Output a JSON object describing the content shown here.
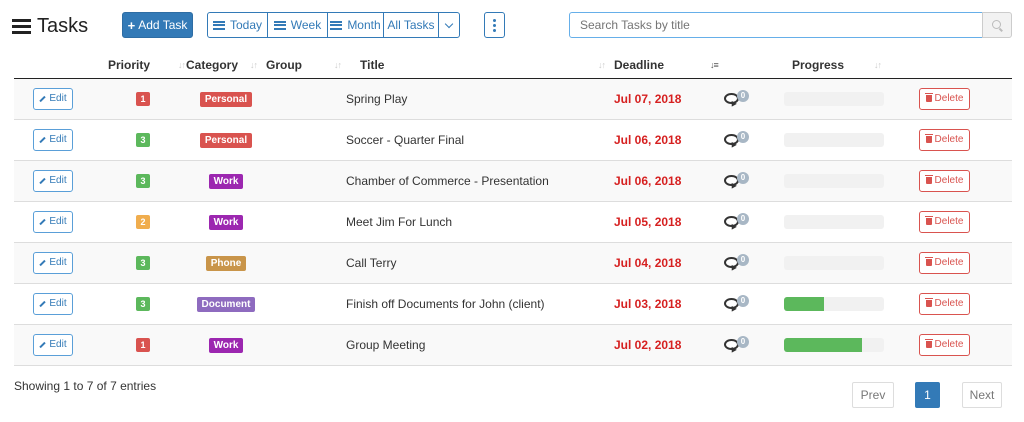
{
  "header": {
    "title": "Tasks",
    "add_task_label": "Add Task",
    "filters": [
      "Today",
      "Week",
      "Month",
      "All Tasks"
    ],
    "search_placeholder": "Search Tasks by title"
  },
  "columns": {
    "priority": "Priority",
    "category": "Category",
    "group": "Group",
    "title": "Title",
    "deadline": "Deadline",
    "progress": "Progress"
  },
  "actions": {
    "edit": "Edit",
    "delete": "Delete"
  },
  "colors": {
    "primary": "#337ab7",
    "danger": "#d9534f",
    "deadline": "#d62020",
    "success": "#5cb85c"
  },
  "priority_colors": {
    "1": "#d9534f",
    "2": "#f0ad4e",
    "3": "#5cb85c"
  },
  "category_colors": {
    "Personal": "#d9534f",
    "Work": "#9c27b0",
    "Phone": "#c9954a",
    "Document": "#8e6bbf"
  },
  "rows": [
    {
      "priority": "1",
      "category": "Personal",
      "group": "",
      "title": "Spring Play",
      "deadline": "Jul 07, 2018",
      "comments": "0",
      "progress": 0
    },
    {
      "priority": "3",
      "category": "Personal",
      "group": "",
      "title": "Soccer - Quarter Final",
      "deadline": "Jul 06, 2018",
      "comments": "0",
      "progress": 0
    },
    {
      "priority": "3",
      "category": "Work",
      "group": "",
      "title": "Chamber of Commerce - Presentation",
      "deadline": "Jul 06, 2018",
      "comments": "0",
      "progress": 0
    },
    {
      "priority": "2",
      "category": "Work",
      "group": "",
      "title": "Meet Jim For Lunch",
      "deadline": "Jul 05, 2018",
      "comments": "0",
      "progress": 0
    },
    {
      "priority": "3",
      "category": "Phone",
      "group": "",
      "title": "Call Terry",
      "deadline": "Jul 04, 2018",
      "comments": "0",
      "progress": 0
    },
    {
      "priority": "3",
      "category": "Document",
      "group": "",
      "title": "Finish off Documents for John (client)",
      "deadline": "Jul 03, 2018",
      "comments": "0",
      "progress": 0.4
    },
    {
      "priority": "1",
      "category": "Work",
      "group": "",
      "title": "Group Meeting",
      "deadline": "Jul 02, 2018",
      "comments": "0",
      "progress": 0.78
    }
  ],
  "footer": {
    "info": "Showing 1 to 7 of 7 entries",
    "prev": "Prev",
    "page": "1",
    "next": "Next"
  }
}
